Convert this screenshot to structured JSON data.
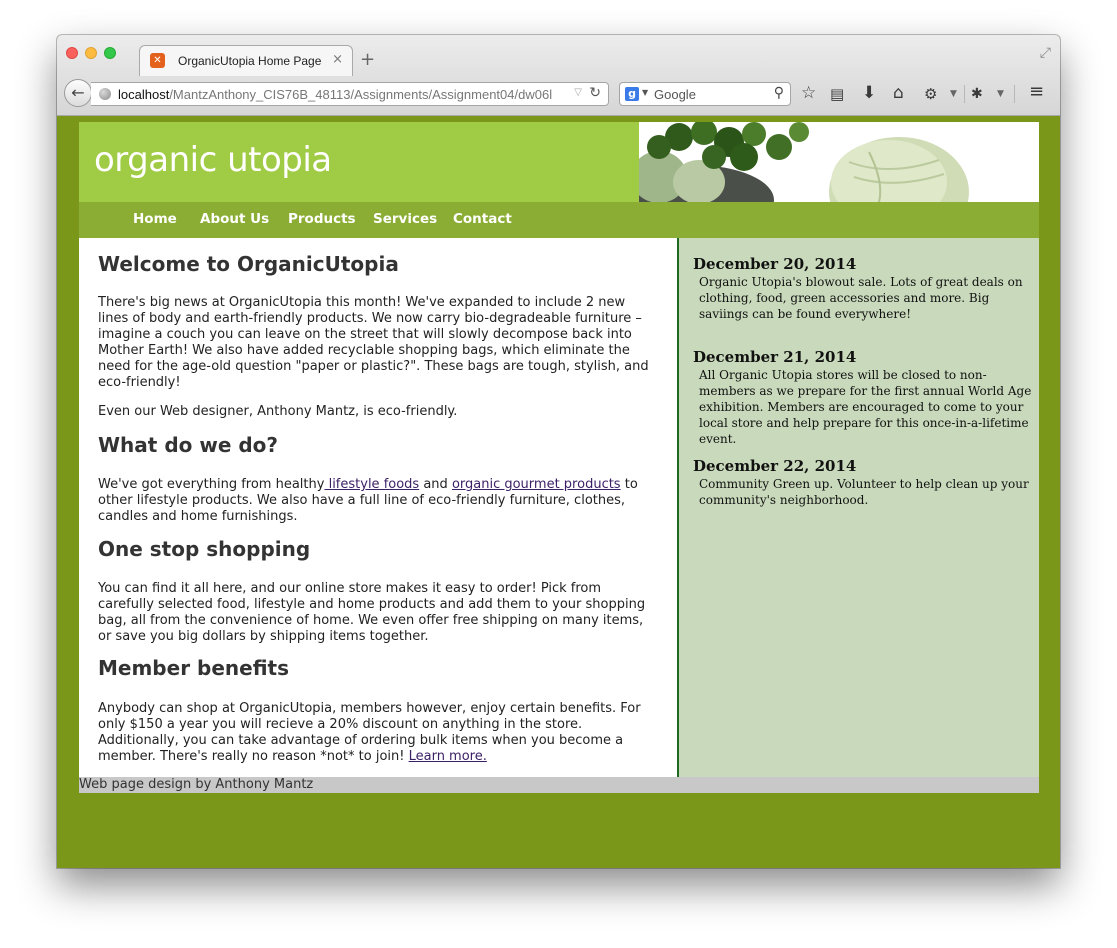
{
  "browser": {
    "tab_title": "OrganicUtopia Home Page",
    "tab_close": "×",
    "new_tab": "+",
    "url_host": "localhost",
    "url_path": "/MantzAnthony_CIS76B_48113/Assignments/Assignment04/dw06l",
    "search_engine": "Google",
    "search_placeholder": "Google"
  },
  "site": {
    "logo": "organic utopia",
    "nav": [
      "Home",
      "About Us",
      "Products",
      "Services",
      "Contact"
    ],
    "main": {
      "h1_welcome": "Welcome to OrganicUtopia",
      "p1": "There's big news at OrganicUtopia this month! We've expanded to include 2 new lines of body and earth-friendly products. We now carry bio-degradeable furniture – imagine a couch you can leave on the street that will slowly decompose back into Mother Earth! We also have added recyclable shopping bags, which eliminate the need for the age-old question \"paper or plastic?\". These bags are tough, stylish, and eco-friendly!",
      "p2": "Even our Web designer, Anthony Mantz, is eco-friendly.",
      "h2_what": "What do we do?",
      "p3_start": "We've got everything from healthy",
      "link_lifestyle": " lifestyle foods",
      "p3_and": " and ",
      "link_gourmet": "organic gourmet products",
      "p3_end": " to other lifestyle products. We also have a full line of eco-friendly furniture, clothes, candles and home furnishings.",
      "h2_shopping": "One stop shopping",
      "p4": "You can find it all here, and our online store makes it easy to order! Pick from carefully selected food, lifestyle and home products and add them to your shopping bag, all from the convenience of home. We even offer free shipping on many items, or save you big dollars by shipping items together.",
      "h2_member": "Member benefits",
      "p5": "Anybody can shop at OrganicUtopia, members however, enjoy certain benefits. For only $150 a year you will recieve a 20% discount on anything in the store. Additionally, you can take advantage of ordering bulk items when you become a member. There's really no reason *not* to join! ",
      "link_learn": "Learn more."
    },
    "news": [
      {
        "date": "December 20, 2014",
        "text": "Organic Utopia's blowout sale. Lots of great deals on clothing, food, green accessories and more. Big saviings can be found everywhere!"
      },
      {
        "date": "December 21, 2014",
        "text": "All Organic Utopia stores will be closed to non-members as we prepare for the first annual World Age exhibition. Members are encouraged to come to your local store and help prepare for this once-in-a-lifetime event."
      },
      {
        "date": "December 22, 2014",
        "text": "Community Green up. Volunteer to help clean up your community's neighborhood."
      }
    ],
    "footer": "Web page design by Anthony Mantz"
  },
  "colors": {
    "page_bg": "#7a971a",
    "header_green": "#a0cb44",
    "nav_green": "#8bad33",
    "sidebar_bg": "#c9d9bb",
    "sidebar_border": "#1f6b1f",
    "link": "#3b1f66"
  }
}
